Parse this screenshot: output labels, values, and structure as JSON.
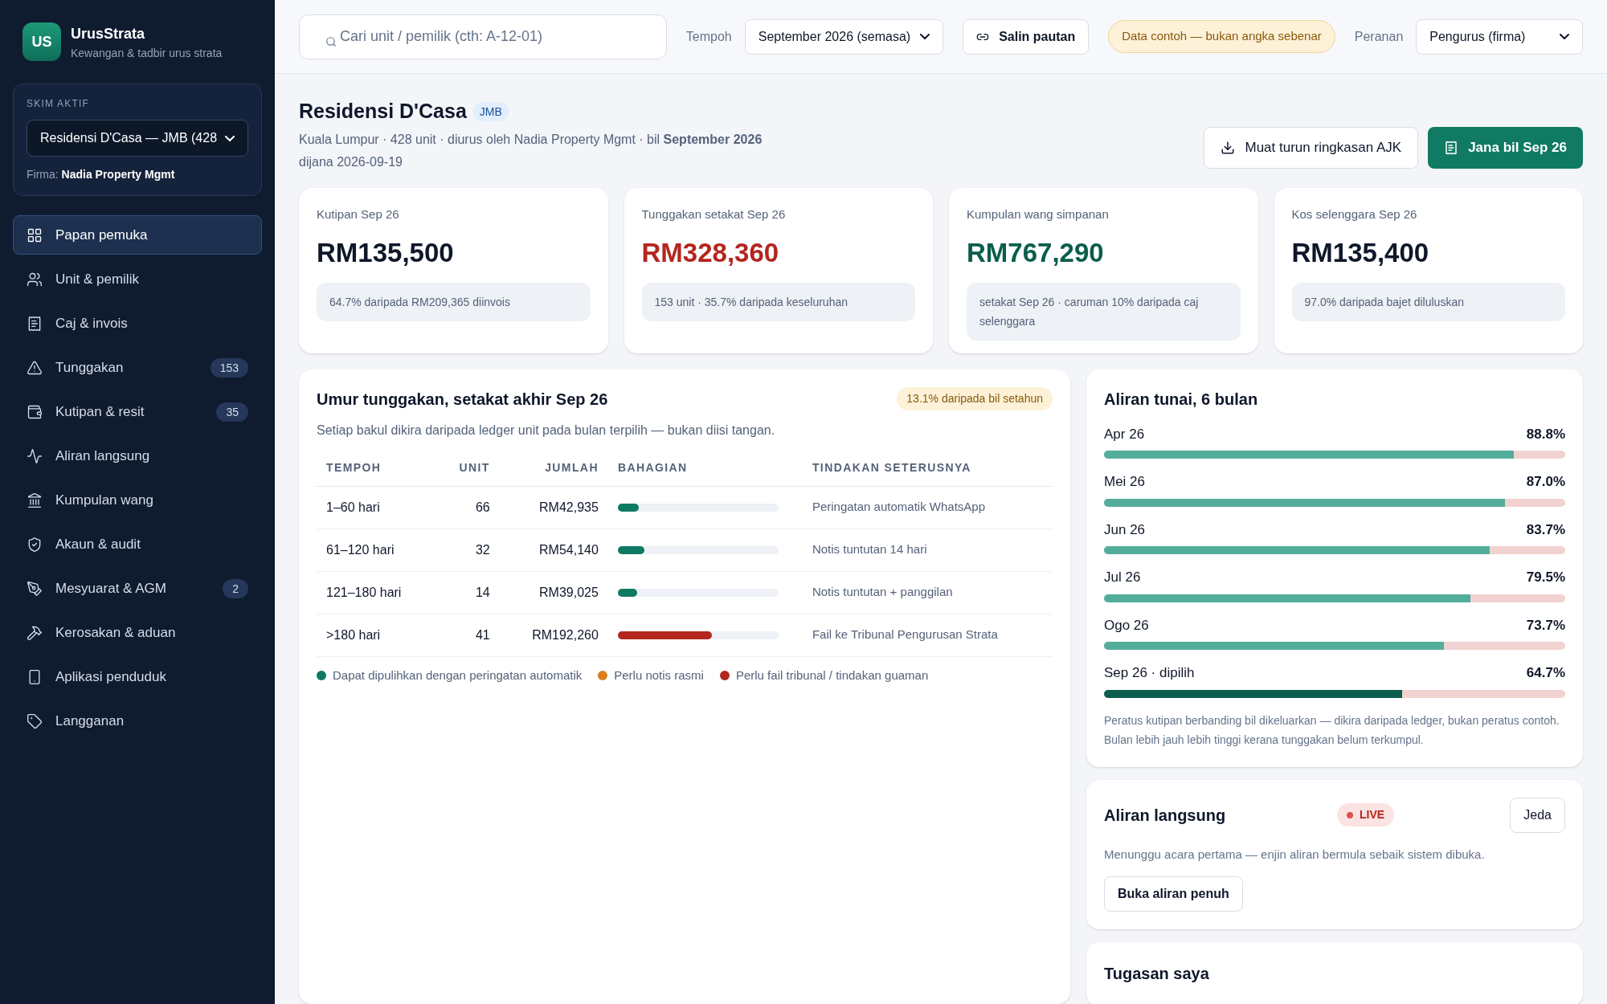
{
  "brand": {
    "logo": "US",
    "name": "UrusStrata",
    "tagline": "Kewangan & tadbir urus strata"
  },
  "scheme": {
    "label": "SKIM AKTIF",
    "value": "Residensi D'Casa — JMB (428",
    "firm_label": "Firma:",
    "firm": "Nadia Property Mgmt"
  },
  "nav": [
    {
      "label": "Papan pemuka",
      "selected": true
    },
    {
      "label": "Unit & pemilik",
      "selected": false
    },
    {
      "label": "Caj & invois",
      "selected": false
    },
    {
      "label": "Tunggakan",
      "selected": false,
      "badge": "153"
    },
    {
      "label": "Kutipan & resit",
      "selected": false,
      "badge": "35"
    },
    {
      "label": "Aliran langsung",
      "selected": false
    },
    {
      "label": "Kumpulan wang",
      "selected": false
    },
    {
      "label": "Akaun & audit",
      "selected": false
    },
    {
      "label": "Mesyuarat & AGM",
      "selected": false,
      "badge": "2"
    },
    {
      "label": "Kerosakan & aduan",
      "selected": false
    },
    {
      "label": "Aplikasi penduduk",
      "selected": false
    },
    {
      "label": "Langganan",
      "selected": false
    }
  ],
  "topbar": {
    "search": {
      "placeholder": "Cari unit / pemilik (cth: A-12-01)"
    },
    "period_label": "Tempoh",
    "period": "September 2026 (semasa)",
    "copy_link": "Salin pautan",
    "notice": "Data contoh — bukan angka sebenar",
    "role_label": "Peranan",
    "role": "Pengurus (firma)"
  },
  "header": {
    "title": "Residensi D'Casa",
    "badge": "JMB",
    "subtitle": "Kuala Lumpur · 428 unit · diurus oleh Nadia Property Mgmt · bil **September 2026**",
    "generated": "dijana 2026-09-19",
    "download": "Muat turun ringkasan AJK",
    "generate": "Jana bil Sep 26"
  },
  "kpis": [
    {
      "label": "Kutipan Sep 26",
      "value": "RM135,500",
      "color": "#0f172a",
      "note": "64.7% daripada RM209,365 diinvois"
    },
    {
      "label": "Tunggakan setakat Sep 26",
      "value": "RM328,360",
      "color": "#b3261e",
      "note": "153 unit · 35.7% daripada keseluruhan"
    },
    {
      "label": "Kumpulan wang simpanan",
      "value": "RM767,290",
      "color": "#0b5e4b",
      "note": "setakat Sep 26 · caruman 10% daripada caj selenggara"
    },
    {
      "label": "Kos selenggara Sep 26",
      "value": "RM135,400",
      "color": "#0f172a",
      "note": "97.0% daripada bajet diluluskan"
    }
  ],
  "aging": {
    "title": "Umur tunggakan, setakat akhir Sep 26",
    "badge": "13.1% daripada bil setahun",
    "subtitle": "Setiap bakul dikira daripada ledger unit pada bulan terpilih — bukan diisi tangan.",
    "columns": [
      "TEMPOH",
      "UNIT",
      "JUMLAH",
      "BAHAGIAN",
      "TINDAKAN SETERUSNYA"
    ],
    "rows": [
      {
        "period": "1–60 hari",
        "units": "66",
        "amount": "RM42,935",
        "level": 0.131,
        "color": "#0f7a63",
        "action": "Peringatan automatik WhatsApp"
      },
      {
        "period": "61–120 hari",
        "units": "32",
        "amount": "RM54,140",
        "level": 0.165,
        "color": "#0f7a63",
        "action": "Notis tuntutan 14 hari"
      },
      {
        "period": "121–180 hari",
        "units": "14",
        "amount": "RM39,025",
        "level": 0.119,
        "color": "#0f7a63",
        "action": "Notis tuntutan + panggilan"
      },
      {
        "period": ">180 hari",
        "units": "41",
        "amount": "RM192,260",
        "level": 0.586,
        "color": "#b3261e",
        "action": "Fail ke Tribunal Pengurusan Strata"
      }
    ],
    "legend": [
      {
        "label": "Dapat dipulihkan dengan peringatan automatik",
        "color": "#0f7a63"
      },
      {
        "label": "Perlu notis rasmi",
        "color": "#d97f1c"
      },
      {
        "label": "Perlu fail tribunal / tindakan guaman",
        "color": "#b3261e"
      }
    ]
  },
  "cashflow": {
    "title": "Aliran tunai, 6 bulan",
    "months": [
      {
        "label": "Apr 26",
        "reading": "88.8%",
        "level": 0.888,
        "selected": false
      },
      {
        "label": "Mei 26",
        "reading": "87.0%",
        "level": 0.87,
        "selected": false
      },
      {
        "label": "Jun 26",
        "reading": "83.7%",
        "level": 0.837,
        "selected": false
      },
      {
        "label": "Jul 26",
        "reading": "79.5%",
        "level": 0.795,
        "selected": false
      },
      {
        "label": "Ogo 26",
        "reading": "73.7%",
        "level": 0.737,
        "selected": false
      },
      {
        "label": "Sep 26 · dipilih",
        "reading": "64.7%",
        "level": 0.647,
        "selected": true
      }
    ],
    "note": "Peratus kutipan berbanding bil dikeluarkan — dikira daripada ledger, bukan peratus contoh. Bulan lebih jauh lebih tinggi kerana tunggakan belum terkumpul."
  },
  "live": {
    "title": "Aliran langsung",
    "status": "LIVE",
    "pause": "Jeda",
    "message": "Menunggu acara pertama — enjin aliran bermula sebaik sistem dibuka.",
    "open": "Buka aliran penuh"
  },
  "tasks": {
    "title": "Tugasan saya"
  }
}
